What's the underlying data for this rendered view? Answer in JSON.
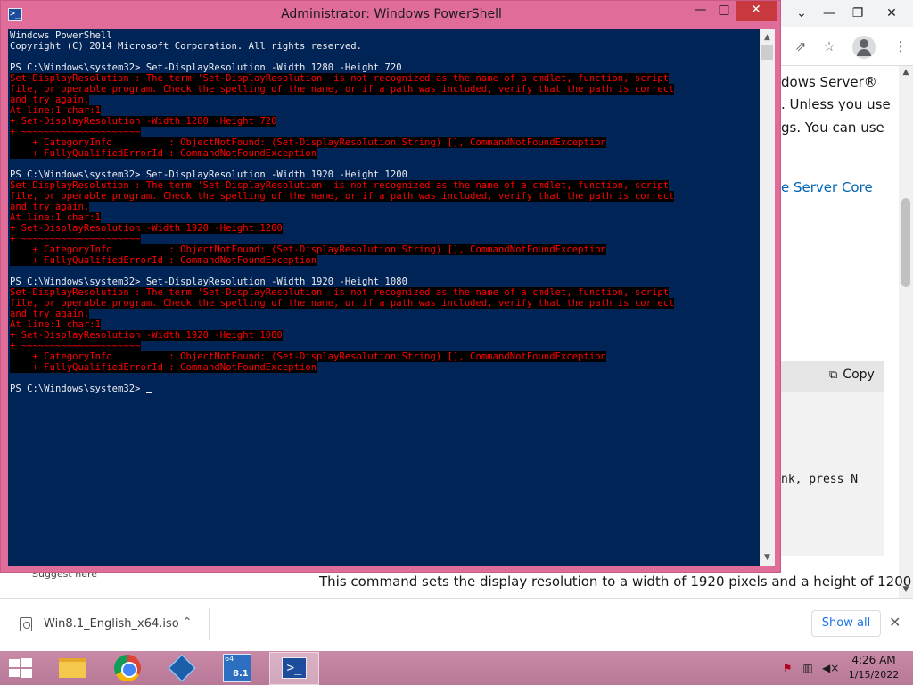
{
  "browser": {
    "controls": {
      "chevron": "⌄",
      "minimize": "—",
      "restore": "❐",
      "close": "✕"
    },
    "toolbar_icons": [
      "share-icon",
      "star-icon",
      "profile-icon",
      "more-icon"
    ],
    "article": {
      "line1": "dows Server®",
      "line2": ". Unless you use",
      "line3": "gs. You can use",
      "link": "e Server Core"
    },
    "code_block": {
      "copy_label": "Copy",
      "code_line": "nk, press N"
    },
    "bottom_text": "This command sets the display resolution to a width of 1920 pixels and a height of 1200",
    "partial_text": "Suggest here"
  },
  "download_shelf": {
    "file_name": "Win8.1_English_x64.iso",
    "show_all_label": "Show all"
  },
  "powershell": {
    "title": "Administrator: Windows PowerShell",
    "buttons": {
      "minimize": "—",
      "maximize": "□",
      "close": "✕"
    },
    "lines": [
      {
        "t": "Windows PowerShell",
        "e": false
      },
      {
        "t": "Copyright (C) 2014 Microsoft Corporation. All rights reserved.",
        "e": false
      },
      {
        "t": "",
        "e": false
      },
      {
        "t": "PS C:\\Windows\\system32> Set-DisplayResolution -Width 1280 -Height 720",
        "e": false
      },
      {
        "t": "Set-DisplayResolution : The term 'Set-DisplayResolution' is not recognized as the name of a cmdlet, function, script",
        "e": true
      },
      {
        "t": "file, or operable program. Check the spelling of the name, or if a path was included, verify that the path is correct",
        "e": true
      },
      {
        "t": "and try again.",
        "e": true
      },
      {
        "t": "At line:1 char:1",
        "e": true
      },
      {
        "t": "+ Set-DisplayResolution -Width 1280 -Height 720",
        "e": true
      },
      {
        "t": "+ ~~~~~~~~~~~~~~~~~~~~~",
        "e": true
      },
      {
        "t": "    + CategoryInfo          : ObjectNotFound: (Set-DisplayResolution:String) [], CommandNotFoundException",
        "e": true
      },
      {
        "t": "    + FullyQualifiedErrorId : CommandNotFoundException",
        "e": true
      },
      {
        "t": "",
        "e": false
      },
      {
        "t": "PS C:\\Windows\\system32> Set-DisplayResolution -Width 1920 -Height 1200",
        "e": false
      },
      {
        "t": "Set-DisplayResolution : The term 'Set-DisplayResolution' is not recognized as the name of a cmdlet, function, script",
        "e": true
      },
      {
        "t": "file, or operable program. Check the spelling of the name, or if a path was included, verify that the path is correct",
        "e": true
      },
      {
        "t": "and try again.",
        "e": true
      },
      {
        "t": "At line:1 char:1",
        "e": true
      },
      {
        "t": "+ Set-DisplayResolution -Width 1920 -Height 1200",
        "e": true
      },
      {
        "t": "+ ~~~~~~~~~~~~~~~~~~~~~",
        "e": true
      },
      {
        "t": "    + CategoryInfo          : ObjectNotFound: (Set-DisplayResolution:String) [], CommandNotFoundException",
        "e": true
      },
      {
        "t": "    + FullyQualifiedErrorId : CommandNotFoundException",
        "e": true
      },
      {
        "t": "",
        "e": false
      },
      {
        "t": "PS C:\\Windows\\system32> Set-DisplayResolution -Width 1920 -Height 1080",
        "e": false
      },
      {
        "t": "Set-DisplayResolution : The term 'Set-DisplayResolution' is not recognized as the name of a cmdlet, function, script",
        "e": true
      },
      {
        "t": "file, or operable program. Check the spelling of the name, or if a path was included, verify that the path is correct",
        "e": true
      },
      {
        "t": "and try again.",
        "e": true
      },
      {
        "t": "At line:1 char:1",
        "e": true
      },
      {
        "t": "+ Set-DisplayResolution -Width 1920 -Height 1080",
        "e": true
      },
      {
        "t": "+ ~~~~~~~~~~~~~~~~~~~~~",
        "e": true
      },
      {
        "t": "    + CategoryInfo          : ObjectNotFound: (Set-DisplayResolution:String) [], CommandNotFoundException",
        "e": true
      },
      {
        "t": "    + FullyQualifiedErrorId : CommandNotFoundException",
        "e": true
      },
      {
        "t": "",
        "e": false
      },
      {
        "t": "PS C:\\Windows\\system32> ",
        "e": false,
        "cursor": true
      }
    ],
    "colors": {
      "background": "#012456",
      "text": "#eeedf0",
      "error_fg": "#ff0000",
      "error_bg": "#000000",
      "frame": "#e06c9a"
    }
  },
  "taskbar": {
    "items": [
      "start-button",
      "file-explorer-icon",
      "chrome-icon",
      "virtualbox-icon",
      "virtualbox-win81-icon",
      "powershell-icon"
    ],
    "vbox81_badge_top": "64",
    "vbox81_badge": "8.1",
    "tray_icons": [
      "action-center-flag-icon",
      "network-icon",
      "volume-muted-icon"
    ],
    "time": "4:26 AM",
    "date": "1/15/2022"
  }
}
